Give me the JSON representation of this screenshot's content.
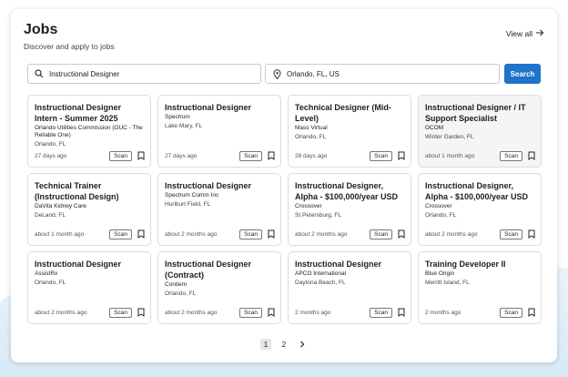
{
  "header": {
    "title": "Jobs",
    "subtitle": "Discover and apply to jobs",
    "view_all": "View all"
  },
  "search": {
    "query_value": "Instructional Designer",
    "location_value": "Orlando, FL, US",
    "button_label": "Search"
  },
  "jobs": [
    {
      "title": "Instructional Designer Intern - Summer 2025",
      "company": "Orlando Utilities Commission (OUC - The Reliable One)",
      "location": "Orlando, FL",
      "posted": "27 days ago",
      "scan_label": "Scan"
    },
    {
      "title": "Instructional Designer",
      "company": "Spectrum",
      "location": "Lake Mary, FL",
      "posted": "27 days ago",
      "scan_label": "Scan"
    },
    {
      "title": "Technical Designer (Mid-Level)",
      "company": "Mass Virtual",
      "location": "Orlando, FL",
      "posted": "28 days ago",
      "scan_label": "Scan"
    },
    {
      "title": "Instructional Designer / IT Support Specialist",
      "company": "OCOM",
      "location": "Winter Garden, FL",
      "posted": "about 1 month ago",
      "scan_label": "Scan"
    },
    {
      "title": "Technical Trainer (Instructional Design)",
      "company": "DaVita Kidney Care",
      "location": "DeLand, FL",
      "posted": "about 1 month ago",
      "scan_label": "Scan"
    },
    {
      "title": "Instructional Designer",
      "company": "Spectrum Comm Inc",
      "location": "Hurlburt Field, FL",
      "posted": "about 2 months ago",
      "scan_label": "Scan"
    },
    {
      "title": "Instructional Designer, Alpha - $100,000/year USD",
      "company": "Crossover",
      "location": "St Petersburg, FL",
      "posted": "about 2 months ago",
      "scan_label": "Scan"
    },
    {
      "title": "Instructional Designer, Alpha - $100,000/year USD",
      "company": "Crossover",
      "location": "Orlando, FL",
      "posted": "about 2 months ago",
      "scan_label": "Scan"
    },
    {
      "title": "Instructional Designer",
      "company": "AssistRx",
      "location": "Orlando, FL",
      "posted": "about 2 months ago",
      "scan_label": "Scan"
    },
    {
      "title": "Instructional Designer (Contract)",
      "company": "Contiem",
      "location": "Orlando, FL",
      "posted": "about 2 months ago",
      "scan_label": "Scan"
    },
    {
      "title": "Instructional Designer",
      "company": "APCO International",
      "location": "Daytona Beach, FL",
      "posted": "2 months ago",
      "scan_label": "Scan"
    },
    {
      "title": "Training Developer II",
      "company": "Blue Origin",
      "location": "Merritt Island, FL",
      "posted": "2 months ago",
      "scan_label": "Scan"
    }
  ],
  "pagination": {
    "pages": [
      "1",
      "2"
    ],
    "current": "1"
  },
  "colors": {
    "accent": "#1f73c8",
    "border": "#dcdcdc"
  }
}
